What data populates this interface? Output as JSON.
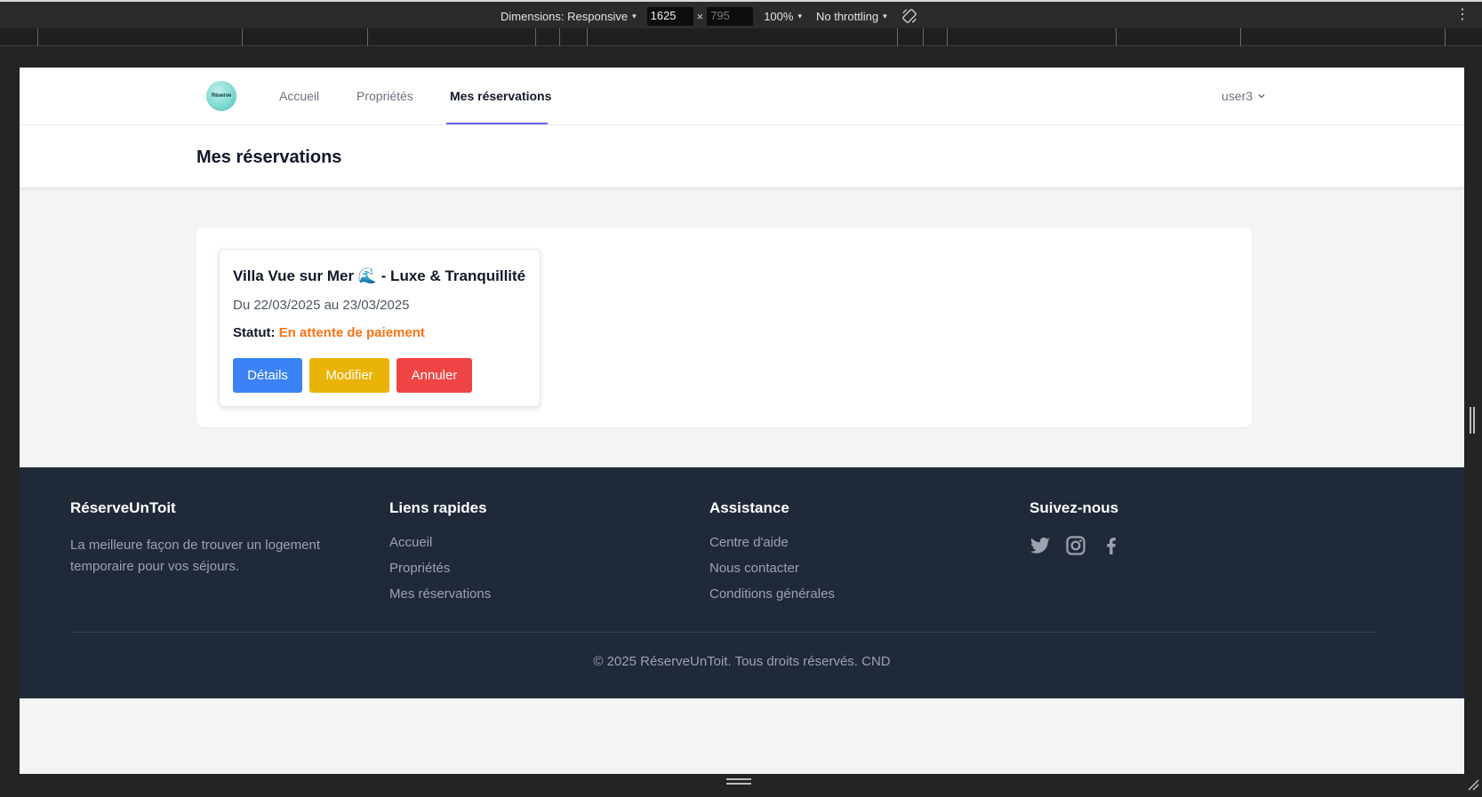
{
  "devtools": {
    "dimensions_label": "Dimensions: Responsive",
    "width_value": "1625",
    "height_value": "795",
    "times": "×",
    "zoom": "100%",
    "throttling": "No throttling",
    "caret": "▾",
    "more": "⋮"
  },
  "navbar": {
    "logo_text": "Réserve",
    "links": [
      {
        "label": "Accueil"
      },
      {
        "label": "Propriétés"
      },
      {
        "label": "Mes réservations",
        "active": true
      }
    ],
    "user": "user3"
  },
  "page": {
    "title": "Mes réservations"
  },
  "reservation": {
    "title": "Villa Vue sur Mer 🌊 - Luxe & Tranquillité",
    "dates": "Du 22/03/2025 au 23/03/2025",
    "status_label": "Statut:",
    "status_value": "En attente de paiement",
    "status_color": "#f97316",
    "buttons": {
      "details": "Détails",
      "edit": "Modifier",
      "cancel": "Annuler"
    }
  },
  "footer": {
    "brand": {
      "heading": "RéserveUnToit",
      "text": "La meilleure façon de trouver un logement temporaire pour vos séjours."
    },
    "quick_links": {
      "heading": "Liens rapides",
      "items": [
        "Accueil",
        "Propriétés",
        "Mes réservations"
      ]
    },
    "assistance": {
      "heading": "Assistance",
      "items": [
        "Centre d'aide",
        "Nous contacter",
        "Conditions générales"
      ]
    },
    "social": {
      "heading": "Suivez-nous",
      "icons": [
        "twitter-icon",
        "instagram-icon",
        "facebook-icon"
      ]
    },
    "copyright": "© 2025 RéserveUnToit. Tous droits réservés. CND"
  },
  "colors": {
    "accent": "#6366f1",
    "details_button": "#3b82f6",
    "edit_button": "#eab308",
    "cancel_button": "#ef4444",
    "footer_bg": "#1f2937"
  }
}
